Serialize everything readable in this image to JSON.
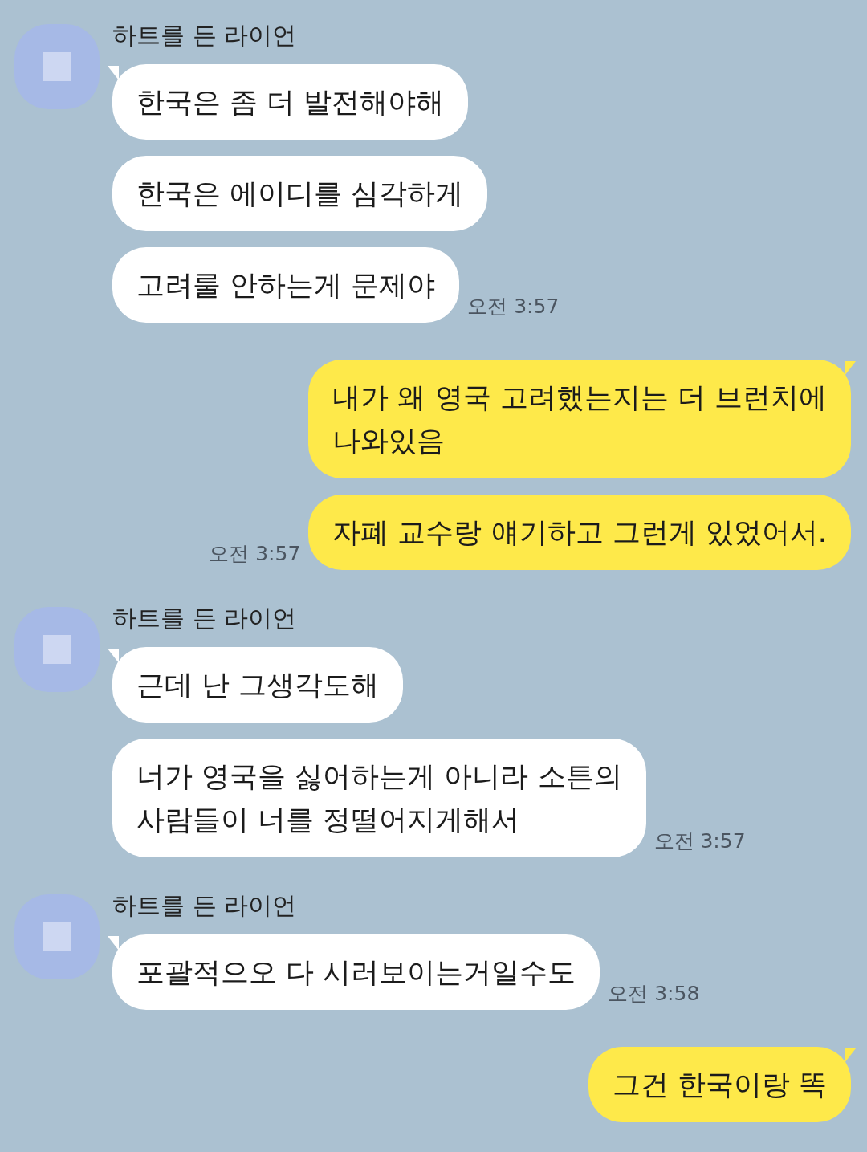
{
  "messages": [
    {
      "kind": "received",
      "sender": "하트를 든 라이언",
      "bubbles": [
        "한국은 좀 더 발전해야해",
        "한국은 에이디를 심각하게",
        "고려룰 안하는게 문제야"
      ],
      "time": "오전 3:57"
    },
    {
      "kind": "sent",
      "bubbles": [
        "내가 왜 영국 고려했는지는 더 브런치에\n나와있음",
        "자폐 교수랑 얘기하고 그런게 있었어서."
      ],
      "time": "오전 3:57"
    },
    {
      "kind": "received",
      "sender": "하트를 든 라이언",
      "bubbles": [
        "근데 난 그생각도해",
        "너가 영국을 싫어하는게 아니라 소튼의\n사람들이 너를 정떨어지게해서"
      ],
      "time": "오전 3:57"
    },
    {
      "kind": "received",
      "sender": "하트를 든 라이언",
      "bubbles": [
        "포괄적으오 다 시러보이는거일수도"
      ],
      "time": "오전 3:58"
    },
    {
      "kind": "sent",
      "bubbles": [
        "그건 한국이랑 똑"
      ]
    }
  ]
}
